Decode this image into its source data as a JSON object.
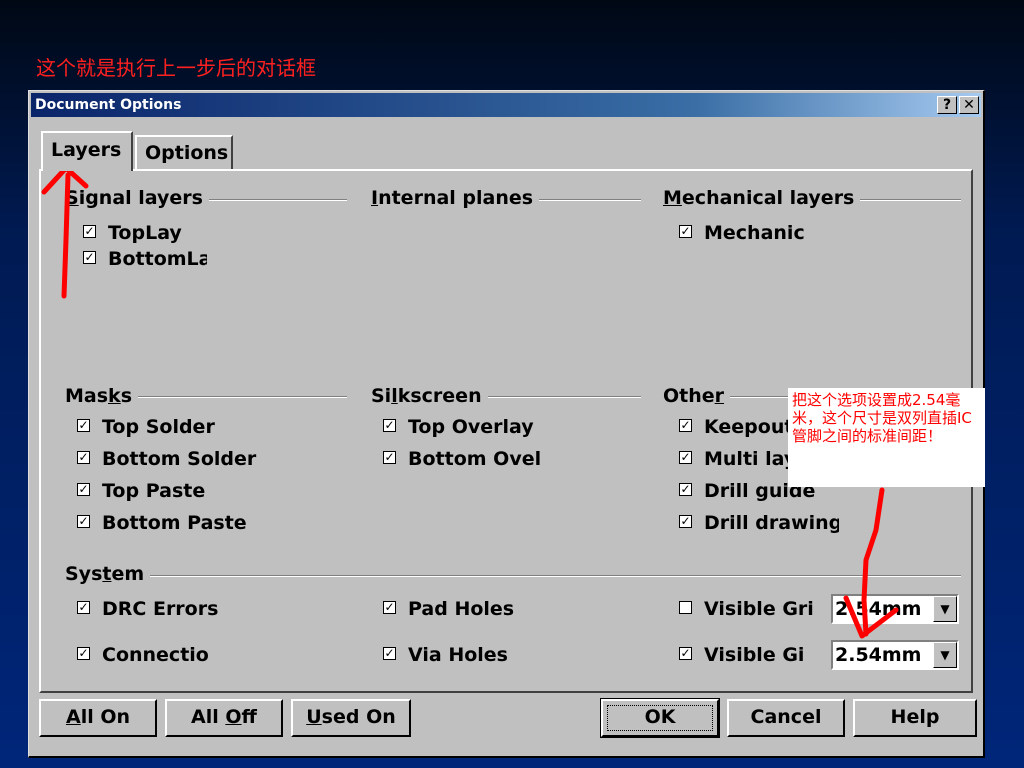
{
  "slide": {
    "caption": "这个就是执行上一步后的对话框"
  },
  "dialog": {
    "title": "Document Options",
    "help_button": "?",
    "close_button": "✕",
    "tabs": [
      {
        "label": "Layers",
        "active": true
      },
      {
        "label": "Options",
        "active": false
      }
    ],
    "groups": {
      "signal": {
        "title_u": "S",
        "title_rest": "ignal layers",
        "items": [
          {
            "label": "TopLay",
            "checked": true
          },
          {
            "label": "BottomLa",
            "checked": true
          }
        ]
      },
      "internal": {
        "title_u": "I",
        "title_rest": "nternal planes",
        "items": []
      },
      "mechanical": {
        "title_u": "M",
        "title_rest": "echanical layers",
        "items": [
          {
            "label": "Mechanic",
            "checked": true
          }
        ]
      },
      "masks": {
        "title_pre": "Mas",
        "title_u": "k",
        "title_post": "s",
        "items": [
          {
            "label": "Top Solder",
            "checked": true
          },
          {
            "label": "Bottom Solder",
            "checked": true
          },
          {
            "label": "Top Paste",
            "checked": true
          },
          {
            "label": "Bottom Paste",
            "checked": true
          }
        ]
      },
      "silkscreen": {
        "title_pre": "Si",
        "title_u": "l",
        "title_post": "kscreen",
        "items": [
          {
            "label": "Top Overlay",
            "checked": true
          },
          {
            "label": "Bottom Ovel",
            "checked": true
          }
        ]
      },
      "other": {
        "title_pre": "Othe",
        "title_u": "r",
        "title_post": "",
        "items": [
          {
            "label": "Keepout",
            "checked": true
          },
          {
            "label": "Multi lay",
            "checked": true
          },
          {
            "label": "Drill guide",
            "checked": true
          },
          {
            "label": "Drill drawing",
            "checked": true
          }
        ]
      },
      "system": {
        "title_pre": "Sys",
        "title_u": "t",
        "title_post": "em"
      }
    },
    "system_rows": [
      {
        "col1": {
          "label": "DRC Errors",
          "checked": true
        },
        "col2": {
          "label": "Pad Holes",
          "checked": true
        },
        "col3": {
          "label": "Visible Gri",
          "checked": false
        },
        "combo": "2.54mm"
      },
      {
        "col1": {
          "label": "Connectio",
          "checked": true
        },
        "col2": {
          "label": "Via Holes",
          "checked": true
        },
        "col3": {
          "label": "Visible Gi",
          "checked": true
        },
        "combo": "2.54mm"
      }
    ],
    "buttons": {
      "all_on": {
        "u": "A",
        "rest": "ll On"
      },
      "all_off": {
        "pre": "All ",
        "u": "O",
        "rest": "ff"
      },
      "used_on": {
        "u": "U",
        "rest": "sed On"
      },
      "ok": "OK",
      "cancel": "Cancel",
      "help": "Help"
    }
  },
  "annotation": {
    "note": "把这个选项设置成2.54毫米，这个尺寸是双列直插IC管脚之间的标准间距！",
    "color": "#ff0000"
  },
  "check_glyph": "✓"
}
